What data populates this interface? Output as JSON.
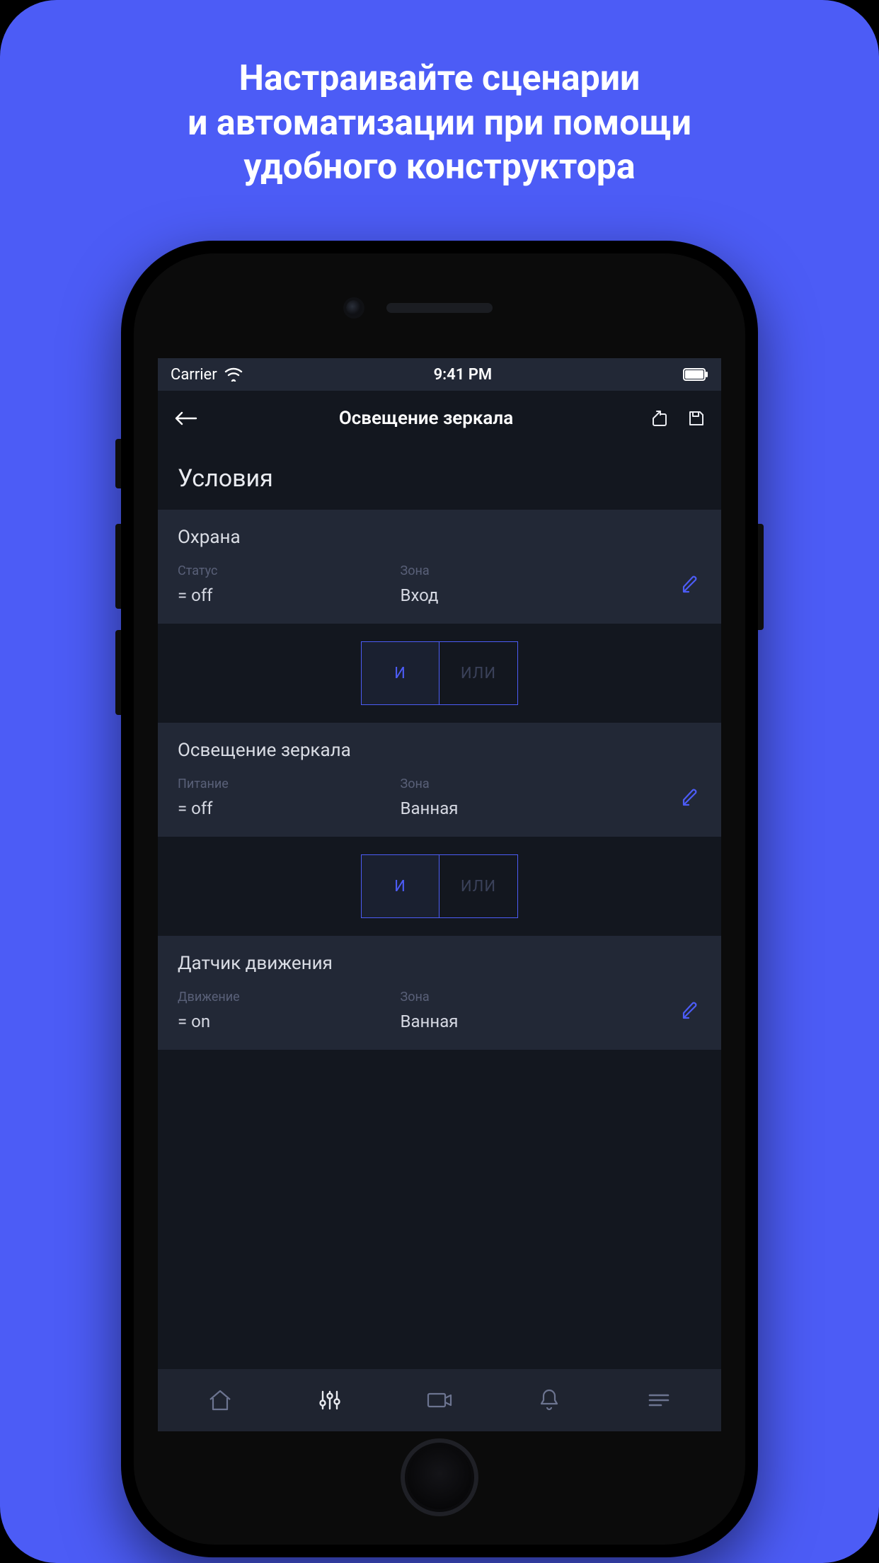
{
  "promo": {
    "line1": "Настраивайте сценарии",
    "line2": "и автоматизации при помощи",
    "line3": "удобного конструктора"
  },
  "statusbar": {
    "carrier": "Carrier",
    "time": "9:41 PM"
  },
  "navbar": {
    "title": "Освещение зеркала"
  },
  "section_title": "Условия",
  "operators": {
    "and": "И",
    "or": "ИЛИ"
  },
  "conditions": [
    {
      "title": "Охрана",
      "col1_label": "Статус",
      "col1_value": "= off",
      "col2_label": "Зона",
      "col2_value": "Вход"
    },
    {
      "title": "Освещение зеркала",
      "col1_label": "Питание",
      "col1_value": "= off",
      "col2_label": "Зона",
      "col2_value": "Ванная"
    },
    {
      "title": "Датчик движения",
      "col1_label": "Движение",
      "col1_value": "= on",
      "col2_label": "Зона",
      "col2_value": "Ванная"
    }
  ],
  "colors": {
    "accent": "#4C5CF6",
    "bg_dark": "#13171f",
    "card": "#222836",
    "muted": "#596078"
  }
}
